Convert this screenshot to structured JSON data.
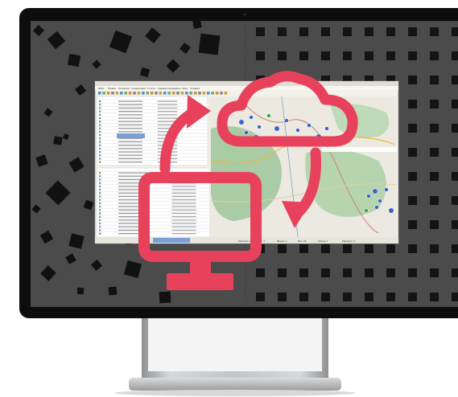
{
  "illustration": {
    "subject": "desktop-monitor-cloud-sync",
    "overlay_icons": [
      "cloud-icon",
      "monitor-icon",
      "sync-arrow-clockwise-icon",
      "sync-arrow-down-icon"
    ],
    "colors": {
      "bezel": "#0d0d0d",
      "screen_bg": "#4b4b4b",
      "squares": "#121212",
      "accent_red": "#e8415b",
      "map_green": "#9ec59a",
      "map_pin_blue": "#3a62c9",
      "stand_silver": "#b5b7b9"
    }
  },
  "app_window": {
    "menu_items": [
      "Файл",
      "Правка",
      "Операции",
      "Справочники",
      "Отчеты",
      "Администрирование",
      "Окна",
      "Справка"
    ],
    "status_bar_items": [
      "Записей: 1",
      "Агент: 1",
      "Время: 1",
      "Все: 43",
      "Обход: 4",
      "Маршрут: 1"
    ]
  }
}
